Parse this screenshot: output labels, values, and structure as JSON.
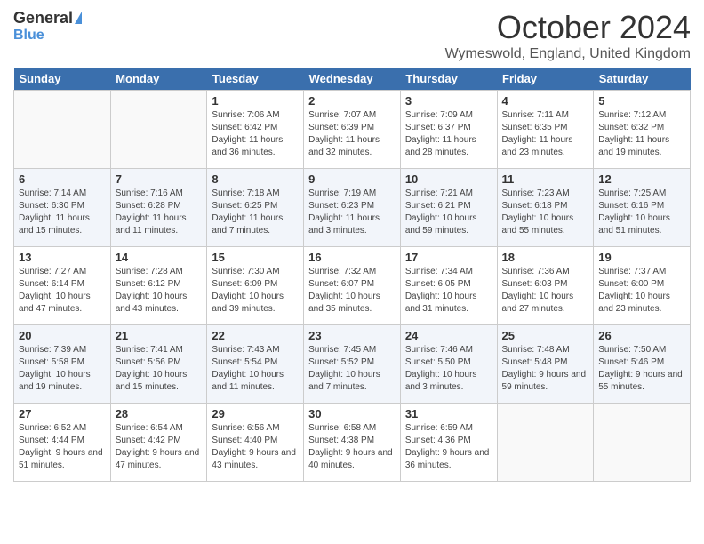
{
  "logo": {
    "general": "General",
    "blue": "Blue"
  },
  "title": "October 2024",
  "location": "Wymeswold, England, United Kingdom",
  "days_of_week": [
    "Sunday",
    "Monday",
    "Tuesday",
    "Wednesday",
    "Thursday",
    "Friday",
    "Saturday"
  ],
  "weeks": [
    [
      {
        "day": "",
        "info": ""
      },
      {
        "day": "",
        "info": ""
      },
      {
        "day": "1",
        "info": "Sunrise: 7:06 AM\nSunset: 6:42 PM\nDaylight: 11 hours and 36 minutes."
      },
      {
        "day": "2",
        "info": "Sunrise: 7:07 AM\nSunset: 6:39 PM\nDaylight: 11 hours and 32 minutes."
      },
      {
        "day": "3",
        "info": "Sunrise: 7:09 AM\nSunset: 6:37 PM\nDaylight: 11 hours and 28 minutes."
      },
      {
        "day": "4",
        "info": "Sunrise: 7:11 AM\nSunset: 6:35 PM\nDaylight: 11 hours and 23 minutes."
      },
      {
        "day": "5",
        "info": "Sunrise: 7:12 AM\nSunset: 6:32 PM\nDaylight: 11 hours and 19 minutes."
      }
    ],
    [
      {
        "day": "6",
        "info": "Sunrise: 7:14 AM\nSunset: 6:30 PM\nDaylight: 11 hours and 15 minutes."
      },
      {
        "day": "7",
        "info": "Sunrise: 7:16 AM\nSunset: 6:28 PM\nDaylight: 11 hours and 11 minutes."
      },
      {
        "day": "8",
        "info": "Sunrise: 7:18 AM\nSunset: 6:25 PM\nDaylight: 11 hours and 7 minutes."
      },
      {
        "day": "9",
        "info": "Sunrise: 7:19 AM\nSunset: 6:23 PM\nDaylight: 11 hours and 3 minutes."
      },
      {
        "day": "10",
        "info": "Sunrise: 7:21 AM\nSunset: 6:21 PM\nDaylight: 10 hours and 59 minutes."
      },
      {
        "day": "11",
        "info": "Sunrise: 7:23 AM\nSunset: 6:18 PM\nDaylight: 10 hours and 55 minutes."
      },
      {
        "day": "12",
        "info": "Sunrise: 7:25 AM\nSunset: 6:16 PM\nDaylight: 10 hours and 51 minutes."
      }
    ],
    [
      {
        "day": "13",
        "info": "Sunrise: 7:27 AM\nSunset: 6:14 PM\nDaylight: 10 hours and 47 minutes."
      },
      {
        "day": "14",
        "info": "Sunrise: 7:28 AM\nSunset: 6:12 PM\nDaylight: 10 hours and 43 minutes."
      },
      {
        "day": "15",
        "info": "Sunrise: 7:30 AM\nSunset: 6:09 PM\nDaylight: 10 hours and 39 minutes."
      },
      {
        "day": "16",
        "info": "Sunrise: 7:32 AM\nSunset: 6:07 PM\nDaylight: 10 hours and 35 minutes."
      },
      {
        "day": "17",
        "info": "Sunrise: 7:34 AM\nSunset: 6:05 PM\nDaylight: 10 hours and 31 minutes."
      },
      {
        "day": "18",
        "info": "Sunrise: 7:36 AM\nSunset: 6:03 PM\nDaylight: 10 hours and 27 minutes."
      },
      {
        "day": "19",
        "info": "Sunrise: 7:37 AM\nSunset: 6:00 PM\nDaylight: 10 hours and 23 minutes."
      }
    ],
    [
      {
        "day": "20",
        "info": "Sunrise: 7:39 AM\nSunset: 5:58 PM\nDaylight: 10 hours and 19 minutes."
      },
      {
        "day": "21",
        "info": "Sunrise: 7:41 AM\nSunset: 5:56 PM\nDaylight: 10 hours and 15 minutes."
      },
      {
        "day": "22",
        "info": "Sunrise: 7:43 AM\nSunset: 5:54 PM\nDaylight: 10 hours and 11 minutes."
      },
      {
        "day": "23",
        "info": "Sunrise: 7:45 AM\nSunset: 5:52 PM\nDaylight: 10 hours and 7 minutes."
      },
      {
        "day": "24",
        "info": "Sunrise: 7:46 AM\nSunset: 5:50 PM\nDaylight: 10 hours and 3 minutes."
      },
      {
        "day": "25",
        "info": "Sunrise: 7:48 AM\nSunset: 5:48 PM\nDaylight: 9 hours and 59 minutes."
      },
      {
        "day": "26",
        "info": "Sunrise: 7:50 AM\nSunset: 5:46 PM\nDaylight: 9 hours and 55 minutes."
      }
    ],
    [
      {
        "day": "27",
        "info": "Sunrise: 6:52 AM\nSunset: 4:44 PM\nDaylight: 9 hours and 51 minutes."
      },
      {
        "day": "28",
        "info": "Sunrise: 6:54 AM\nSunset: 4:42 PM\nDaylight: 9 hours and 47 minutes."
      },
      {
        "day": "29",
        "info": "Sunrise: 6:56 AM\nSunset: 4:40 PM\nDaylight: 9 hours and 43 minutes."
      },
      {
        "day": "30",
        "info": "Sunrise: 6:58 AM\nSunset: 4:38 PM\nDaylight: 9 hours and 40 minutes."
      },
      {
        "day": "31",
        "info": "Sunrise: 6:59 AM\nSunset: 4:36 PM\nDaylight: 9 hours and 36 minutes."
      },
      {
        "day": "",
        "info": ""
      },
      {
        "day": "",
        "info": ""
      }
    ]
  ]
}
